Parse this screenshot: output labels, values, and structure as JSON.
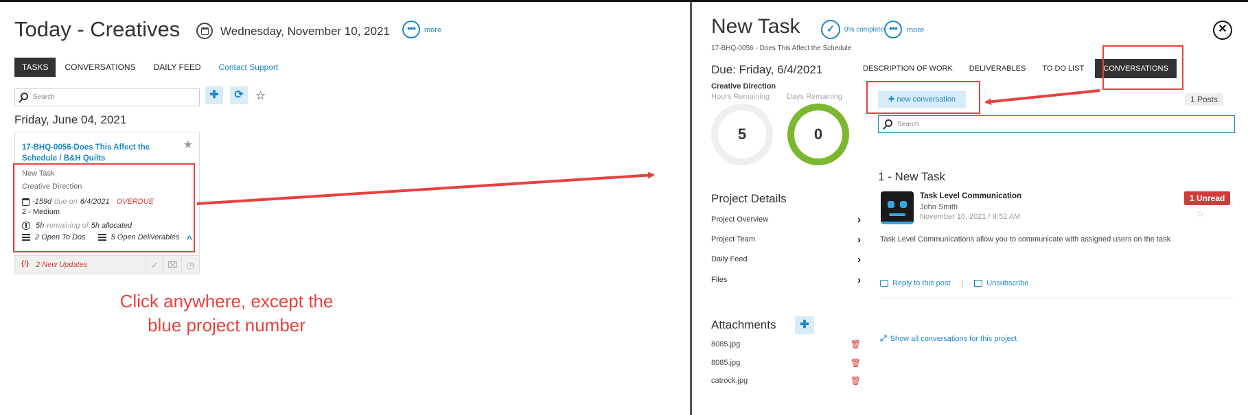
{
  "left": {
    "title": "Today - Creatives",
    "date": "Wednesday, November 10, 2021",
    "more_label": "more",
    "tabs": [
      "TASKS",
      "CONVERSATIONS",
      "DAILY FEED",
      "Contact Support"
    ],
    "search_placeholder": "Search",
    "day_heading": "Friday, June 04, 2021",
    "card": {
      "project_link": "17-BHQ-0056-Does This Affect the Schedule / B&H Quilts",
      "task_name": "New Task",
      "category": "Creative Direction",
      "days_value": "-159d",
      "due_word": "due on",
      "due_date": "6/4/2021",
      "overdue": "OVERDUE",
      "priority": "2 - Medium",
      "hours_remaining": "5h",
      "remaining_word": "remaining of",
      "hours_allocated": "5h allocated",
      "open_todos": "2 Open To Dos",
      "open_deliverables": "5 Open Deliverables",
      "updates": "2 New Updates"
    },
    "annotation": "Click anywhere, except the blue project number"
  },
  "right": {
    "title": "New Task",
    "percent_complete": "0% complete",
    "more_label": "more",
    "subtitle": "17-BHQ-0056 - Does This Affect the Schedule",
    "due": "Due: Friday, 6/4/2021",
    "category": "Creative Direction",
    "hours_label": "Hours Remaining",
    "days_label": "Days Remaining",
    "hours_value": "5",
    "days_value": "0",
    "tabs": [
      "DESCRIPTION OF WORK",
      "DELIVERABLES",
      "TO DO LIST",
      "CONVERSATIONS"
    ],
    "new_conversation": "new conversation",
    "posts_count": "1 Posts",
    "search_placeholder": "Search",
    "project_details_title": "Project Details",
    "project_details": [
      "Project Overview",
      "Project Team",
      "Daily Feed",
      "Files"
    ],
    "attachments_title": "Attachments",
    "attachments": [
      "8085.jpg",
      "8085.jpg",
      "catrock.jpg"
    ],
    "conversation_heading": "1 - New Task",
    "message": {
      "title": "Task Level Communication",
      "author": "John Smith",
      "time": "November 10, 2021 / 9:52 AM",
      "unread": "1 Unread",
      "body": "Task Level Communications allow you to communicate with assigned users on the task",
      "reply": "Reply to this post",
      "unsubscribe": "Unsubscribe"
    },
    "show_all": "Show all conversations for this project"
  },
  "colors": {
    "accent": "#1f86c8",
    "annotation_red": "#e8413e",
    "overdue_red": "#d23b3b",
    "ring_green": "#7cb82f",
    "ring_grey": "#efefef"
  }
}
